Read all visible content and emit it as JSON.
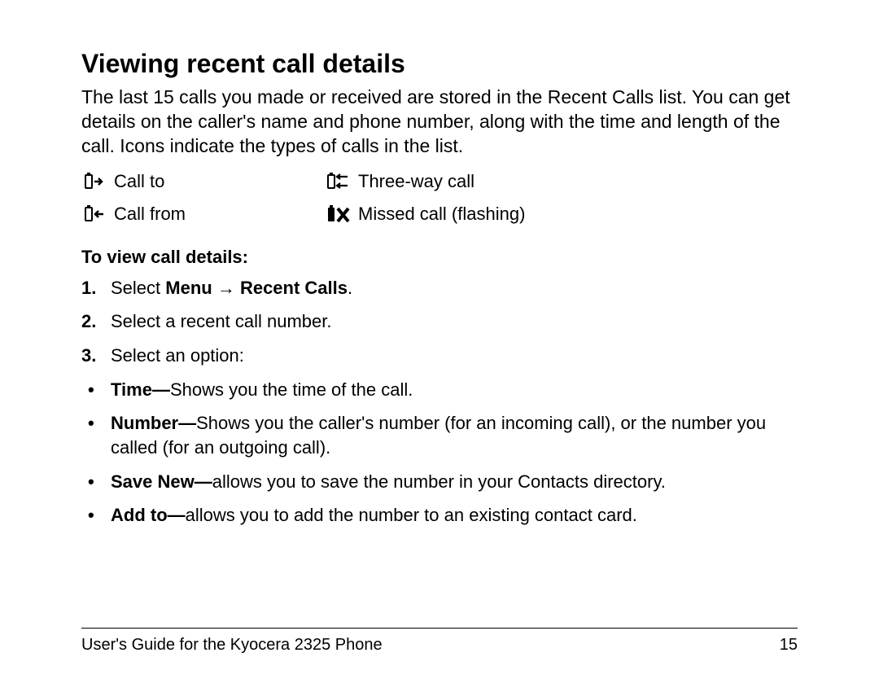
{
  "heading": "Viewing recent call details",
  "intro": "The last 15 calls you made or received are stored in the Recent Calls list. You can get details on the caller's name and phone number, along with the time and length of the call. Icons indicate the types of calls in the list.",
  "icons": {
    "call_to": "Call to",
    "call_from": "Call from",
    "three_way": "Three-way call",
    "missed": "Missed call (flashing)"
  },
  "subhead": "To view call details:",
  "step1_pre": "Select ",
  "step1_menu": "Menu",
  "step1_arrow": " → ",
  "step1_recent": "Recent Calls",
  "step1_post": ".",
  "step2": "Select a recent call number.",
  "step3": "Select an option:",
  "bullets": {
    "time_b": "Time—",
    "time_t": "Shows you the time of the call.",
    "number_b": "Number—",
    "number_t": "Shows you the caller's number (for an incoming call), or the number you called (for an outgoing call).",
    "save_b": "Save New—",
    "save_t": "allows you to save the number in your Contacts directory.",
    "add_b": "Add to—",
    "add_t": "allows you to add the number to an existing contact card."
  },
  "footer_left": "User's Guide for the Kyocera 2325 Phone",
  "footer_right": "15"
}
